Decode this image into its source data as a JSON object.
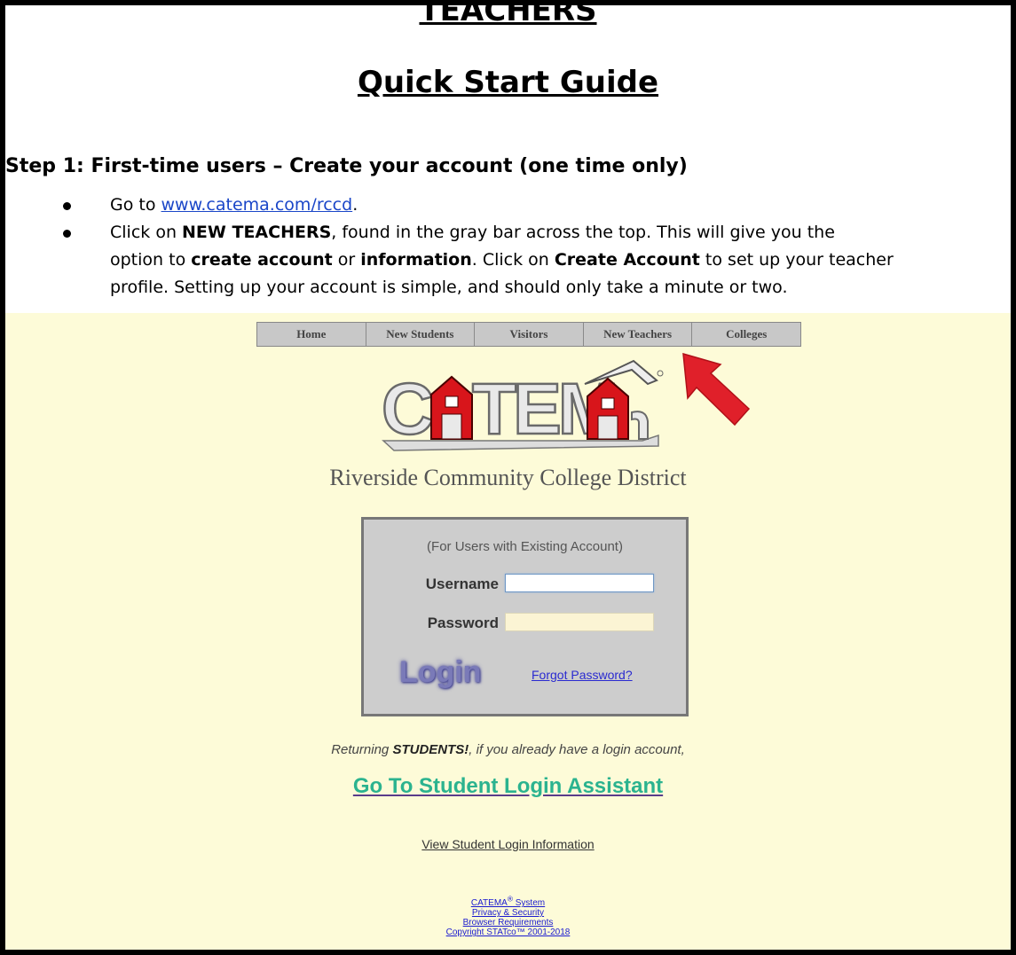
{
  "document": {
    "title_line1": "TEACHERS",
    "title_line2": "Quick Start Guide",
    "step1_heading": "Step 1: First-time users – Create your account (one time only)",
    "bullet1": {
      "prefix": "Go to ",
      "link": "www.catema.com/rccd",
      "suffix": "."
    },
    "bullet2": {
      "p1": "Click on ",
      "b1": "NEW TEACHERS",
      "p2": ", found in the gray bar across the top.  This will give you the",
      "p3": "option to ",
      "b2": "create account",
      "p4": " or ",
      "b3": "information",
      "p5": ". Click on ",
      "b4": "Create Account",
      "p6": " to set up your teacher",
      "p7": "profile.  Setting up your account is simple, and should only take a minute or two."
    }
  },
  "screenshot": {
    "nav": [
      "Home",
      "New Students",
      "Visitors",
      "New Teachers",
      "Colleges"
    ],
    "logo_text": "CATEMA",
    "district": "Riverside Community College District",
    "login": {
      "existing": "(For Users with Existing Account)",
      "username_label": "Username",
      "username_value": "",
      "password_label": "Password",
      "password_value": "",
      "login_button": "Login",
      "forgot_link": "Forgot Password?"
    },
    "returning": {
      "prefix": "Returning ",
      "bold": "STUDENTS!",
      "suffix": ", if you already have a login account,"
    },
    "assistant_link": "Go To Student Login Assistant",
    "view_info_link": "View Student Login Information",
    "footer": {
      "system": "CATEMA",
      "system_mark": "®",
      "system_suffix": " System",
      "privacy": "Privacy & Security",
      "browser": "Browser Requirements",
      "copyright": "Copyright STATco™ 2001-2018"
    }
  },
  "colors": {
    "screenshot_bg": "#fdfbd8",
    "nav_bg": "#c8c8c8",
    "login_box_bg": "#cdcdcd",
    "assistant_link": "#2bb38f",
    "arrow": "#e0202a",
    "link": "#1a46c8"
  },
  "icons": [
    "red-arrow-icon",
    "catema-logo"
  ]
}
